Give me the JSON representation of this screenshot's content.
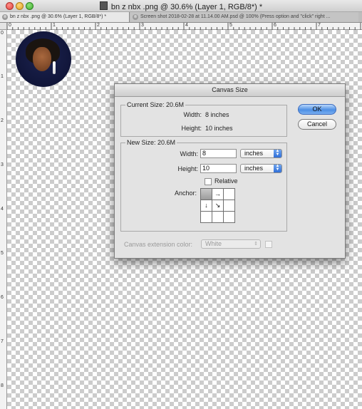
{
  "window": {
    "title": "bn z nbx .png @ 30.6% (Layer 1, RGB/8*) *"
  },
  "tabs": [
    {
      "label": "bn z nbx .png @ 30.6% (Layer 1, RGB/8*) *",
      "close": "⊗"
    },
    {
      "label": "Screen shot 2018-02-28 at 11.14.00 AM.psd @ 100% (Press option and \"click\" right ...",
      "close": "⊗"
    }
  ],
  "rulers": {
    "top": [
      "0",
      "1",
      "2",
      "3",
      "4",
      "5",
      "6",
      "7"
    ],
    "left": [
      "0",
      "1",
      "2",
      "3",
      "4",
      "5",
      "6",
      "7",
      "8"
    ]
  },
  "dialog": {
    "title": "Canvas Size",
    "current_size": {
      "legend": "Current Size: 20.6M",
      "width_label": "Width:",
      "width_value": "8 inches",
      "height_label": "Height:",
      "height_value": "10 inches"
    },
    "new_size": {
      "legend": "New Size: 20.6M",
      "width_label": "Width:",
      "width_value": "8",
      "width_unit": "inches",
      "height_label": "Height:",
      "height_value": "10",
      "height_unit": "inches",
      "relative_label": "Relative",
      "relative_checked": false,
      "anchor_label": "Anchor:",
      "anchor_cells": [
        "",
        "→",
        "",
        "↓",
        "↘",
        "",
        "",
        "",
        ""
      ]
    },
    "extension": {
      "label": "Canvas extension color:",
      "value": "White"
    },
    "ok_label": "OK",
    "cancel_label": "Cancel"
  },
  "colors": {
    "ok_button": "#4d8fe4",
    "dialog_bg": "#e3e3e3",
    "avatar_bg": "#1c2350"
  }
}
